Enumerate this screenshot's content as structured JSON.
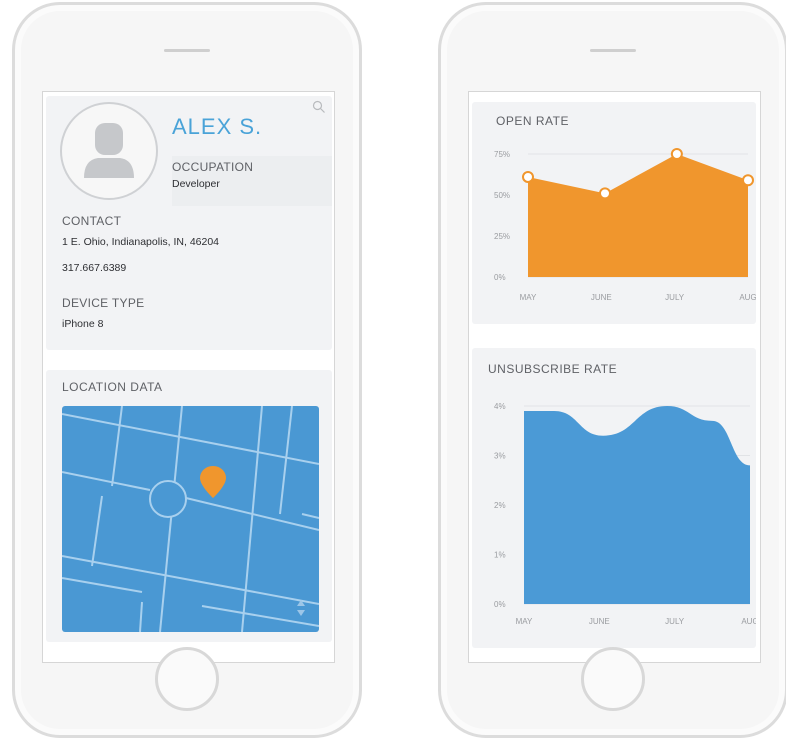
{
  "profile": {
    "name": "ALEX S.",
    "occupation_label": "OCCUPATION",
    "occupation": "Developer",
    "contact_label": "CONTACT",
    "address": "1 E. Ohio, Indianapolis, IN, 46204",
    "phone": "317.667.6389",
    "device_label": "DEVICE TYPE",
    "device": "iPhone 8"
  },
  "location": {
    "title": "LOCATION DATA"
  },
  "colors": {
    "accent_blue": "#4aa3d8",
    "open_rate_orange": "#f0962d",
    "unsub_blue": "#4b9ad6",
    "map_blue": "#4a98d3"
  },
  "open_rate": {
    "title": "OPEN RATE",
    "chart_data": {
      "type": "area",
      "title": "OPEN RATE",
      "categories": [
        "MAY",
        "JUNE",
        "JULY",
        "AUG"
      ],
      "y_ticks": [
        "0%",
        "25%",
        "50%",
        "75%"
      ],
      "ylim": [
        0,
        75
      ],
      "points": [
        {
          "x": 0,
          "y": 61
        },
        {
          "x": 1.05,
          "y": 51
        },
        {
          "x": 2.03,
          "y": 75
        },
        {
          "x": 3,
          "y": 59
        }
      ],
      "color": "#f0962d"
    }
  },
  "unsub_rate": {
    "title": "UNSUBSCRIBE RATE",
    "chart_data": {
      "type": "area",
      "title": "UNSUBSCRIBE RATE",
      "categories": [
        "MAY",
        "JUNE",
        "JULY",
        "AUG"
      ],
      "y_ticks": [
        "0%",
        "1%",
        "2%",
        "3%",
        "4%"
      ],
      "ylim": [
        0,
        4
      ],
      "points": [
        {
          "x": 0,
          "y": 3.9
        },
        {
          "x": 0.4,
          "y": 3.9
        },
        {
          "x": 1.05,
          "y": 3.4
        },
        {
          "x": 1.9,
          "y": 4.0
        },
        {
          "x": 2.5,
          "y": 3.7
        },
        {
          "x": 3,
          "y": 2.8
        }
      ],
      "color": "#4b9ad6"
    }
  }
}
